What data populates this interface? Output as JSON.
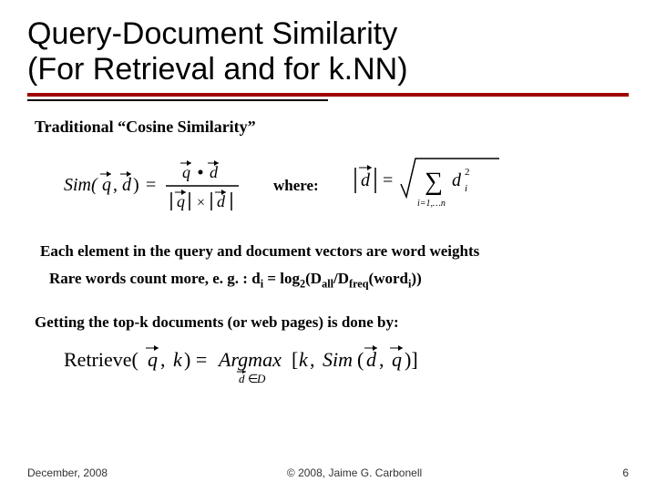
{
  "title_line1": "Query-Document Similarity",
  "title_line2": "(For Retrieval and for k.NN)",
  "subhead": "Traditional “Cosine Similarity”",
  "where_label": "where:",
  "line_elements": "Each element in the query and document vectors are word weights",
  "line_rare_prefix": "Rare words count more, e. g. :  d",
  "line_rare_eq": " = log",
  "line_rare_arg": "(D",
  "line_rare_slash": "/D",
  "line_rare_word": "(word",
  "line_rare_close": "))",
  "sub_i": "i",
  "sub_2": "2",
  "sub_all": "all",
  "sub_freq": "freq",
  "line_topk": "Getting the top-k documents (or web pages) is done by:",
  "sim_formula": {
    "lhs": "Sim(q⃗, d⃗) =",
    "num": "q⃗ • d⃗",
    "den": "|q⃗| × |d⃗|"
  },
  "norm_formula": {
    "lhs": "|d⃗| =",
    "rhs_sum": "∑",
    "rhs_body": "d",
    "rhs_sup": "2",
    "rhs_sub": "i",
    "rhs_limits": "i=1,…n"
  },
  "retrieve_formula": {
    "lhs": "Retrieve(q⃗, k) = Argmax[k, Sim(d⃗, q⃗)]",
    "sub": "d⃗∈D"
  },
  "footer": {
    "date": "December, 2008",
    "copyright": "© 2008, Jaime G. Carbonell",
    "page": "6"
  }
}
